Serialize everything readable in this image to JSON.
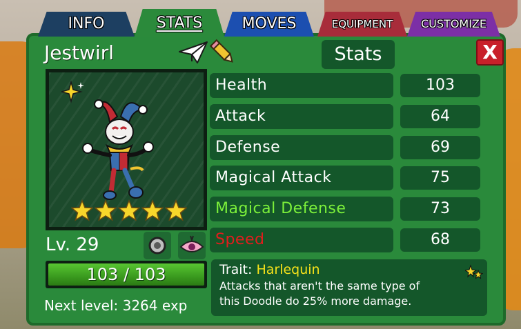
{
  "tabs": [
    {
      "label": "INFO"
    },
    {
      "label": "STATS"
    },
    {
      "label": "MOVES"
    },
    {
      "label": "EQUIPMENT"
    },
    {
      "label": "CUSTOMIZE"
    }
  ],
  "active_tab": "STATS",
  "doodle": {
    "name": "Jestwirl",
    "level": "Lv. 29",
    "hp": "103 / 103",
    "hp_fraction": 1.0,
    "next_level": "Next level: 3264 exp",
    "star_rating": 5
  },
  "panel_title": "Stats",
  "close_label": "X",
  "stats": [
    {
      "label": "Health",
      "value": "103",
      "color": "#ffffff"
    },
    {
      "label": "Attack",
      "value": "64",
      "color": "#ffffff"
    },
    {
      "label": "Defense",
      "value": "69",
      "color": "#ffffff"
    },
    {
      "label": "Magical Attack",
      "value": "75",
      "color": "#ffffff"
    },
    {
      "label": "Magical Defense",
      "value": "73",
      "color": "#7cf03a"
    },
    {
      "label": "Speed",
      "value": "68",
      "color": "#e21d1d"
    }
  ],
  "trait": {
    "prefix": "Trait:",
    "name": "Harlequin",
    "description_line1": "Attacks that aren't the same type of",
    "description_line2": "this Doodle do 25% more damage."
  },
  "icons": {
    "rename": "paper-plane-icon",
    "edit": "pencil-icon",
    "shiny": "sparkle-icon",
    "ability": "gear-icon",
    "type": "eye-icon",
    "trait": "stars-icon"
  },
  "colors": {
    "panel": "#2a8a3b",
    "panel_dark": "#14572a",
    "hp_bar": "#4db32a",
    "close": "#c8202a",
    "star": "#f7d62b",
    "trait_name": "#f7e21a"
  }
}
